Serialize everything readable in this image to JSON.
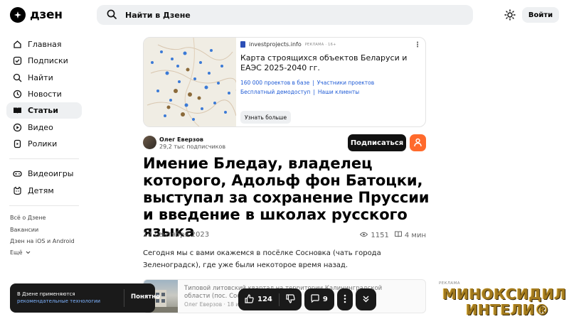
{
  "header": {
    "logo_text": "дзен",
    "search_placeholder": "Найти в Дзене",
    "login_label": "Войти"
  },
  "sidebar": {
    "items": [
      {
        "label": "Главная",
        "icon": "home-icon",
        "active": false
      },
      {
        "label": "Подписки",
        "icon": "subscriptions-icon",
        "active": false
      },
      {
        "label": "Найти",
        "icon": "search-icon",
        "active": false
      },
      {
        "label": "Новости",
        "icon": "news-icon",
        "active": false
      },
      {
        "label": "Статьи",
        "icon": "articles-icon",
        "active": true
      },
      {
        "label": "Видео",
        "icon": "video-icon",
        "active": false
      },
      {
        "label": "Ролики",
        "icon": "shorts-icon",
        "active": false
      }
    ],
    "items2": [
      {
        "label": "Видеоигры",
        "icon": "gamepad-icon"
      },
      {
        "label": "Детям",
        "icon": "kids-icon"
      }
    ],
    "footer_links": [
      "Всё о Дзене",
      "Вакансии",
      "Дзен на iOS и Android",
      "Ещё"
    ]
  },
  "ad_banner": {
    "source": "investprojects.info",
    "tag": "РЕКЛАМА · 16+",
    "title": "Карта строящихся объектов Беларуси и ЕАЭС 2025-2040 гг.",
    "links": [
      [
        "160 000 проектов в базе",
        "Участники проектов"
      ],
      [
        "Бесплатный демодоступ",
        "Наши клиенты"
      ]
    ],
    "more_label": "Узнать больше"
  },
  "author": {
    "name": "Олег Еверзов",
    "subscribers": "29,2 тыс подписчиков",
    "subscribe_label": "Подписаться"
  },
  "article": {
    "title": "Имение Бледау, владелец которого, Адольф фон Батоцки, выступал за сохранение Пруссии и введение в школах русского языка",
    "date": "17 сентября 2023",
    "views": "1151",
    "read_time": "4 мин",
    "text": "Сегодня мы с вами окажемся в посёлке Сосновка (чать города Зеленоградск), где уже были некоторое время назад."
  },
  "embed": {
    "title": "Типовой литовский квартал на территории Калининградской области (пос. Сосновка)",
    "meta": "Олег Еверзов · 18 ию"
  },
  "cookie": {
    "line1": "В Дзене применяются",
    "link": "рекомендательные технологии",
    "ok_label": "Понятно"
  },
  "floating_bar": {
    "likes": "124",
    "comments": "9"
  },
  "side_ad": {
    "tag": "РЕКЛАМА",
    "line1": "МИНОКСИДИЛ",
    "line2": "ИНТЕЛИ®"
  },
  "colors": {
    "accent_orange": "#ff6a2c",
    "link_blue": "#1f5bd6",
    "dark": "#1a1a1a"
  }
}
